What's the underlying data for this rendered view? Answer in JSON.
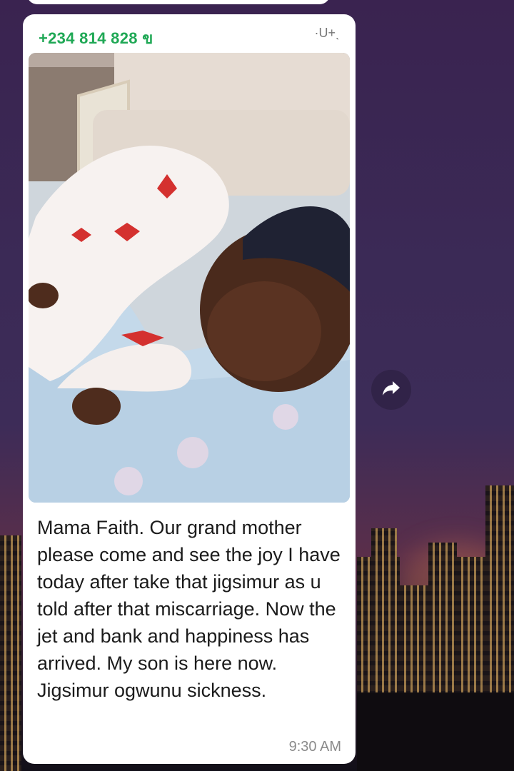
{
  "message": {
    "sender": "+234 814 828 ข",
    "sender_suffix": "·U+ˎ",
    "text": "Mama Faith. Our grand mother  please come and see the joy I have today after take that jigsimur as u told after that miscarriage. Now the jet and bank and happiness has arrived. My son is here now. Jigsimur ogwunu sickness.",
    "time": "9:30 AM",
    "image": "newborn-baby-photo"
  },
  "forward_button": {
    "icon": "forward-arrow-icon"
  },
  "colors": {
    "sender": "#1fa855",
    "bubble": "#ffffff",
    "timestamp": "#8a8a8a",
    "wallpaper_top": "#3a2350"
  }
}
